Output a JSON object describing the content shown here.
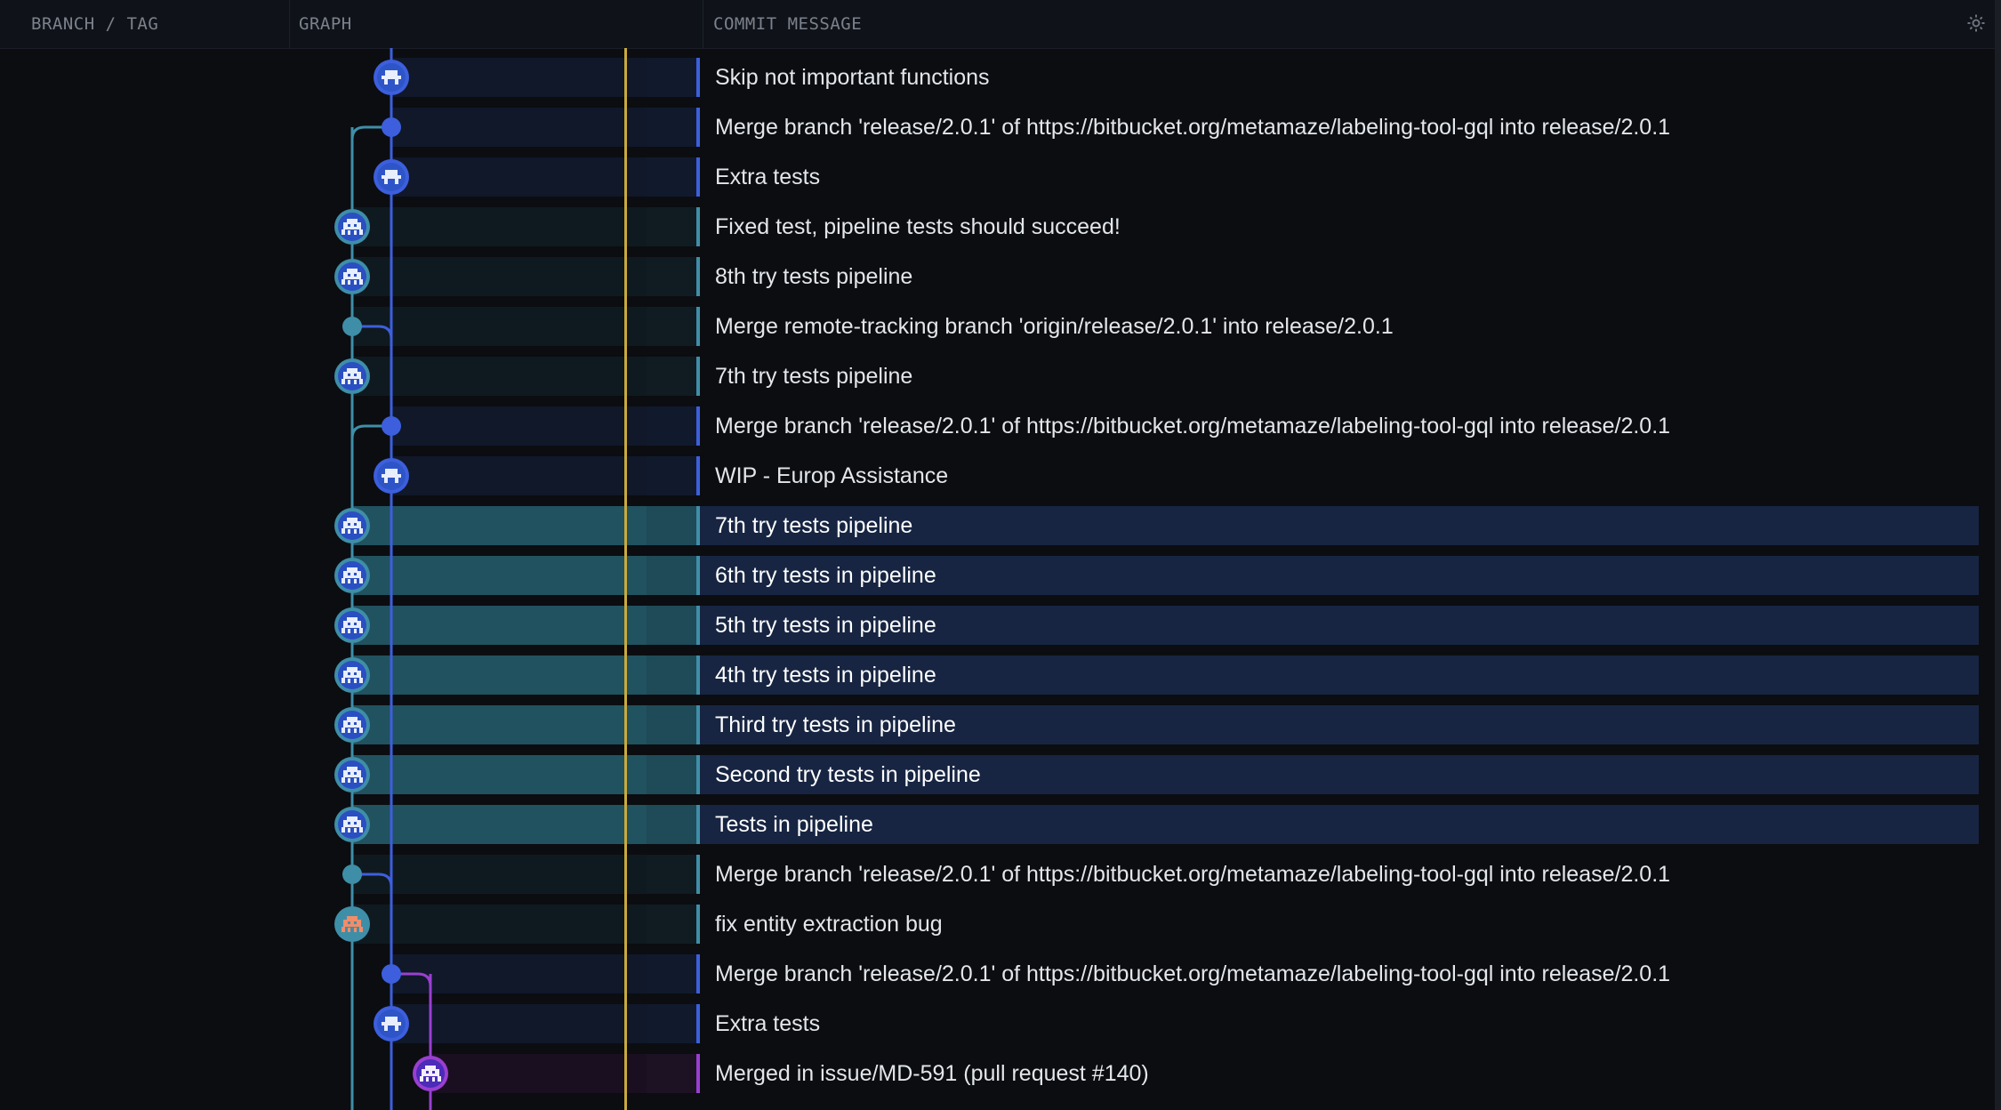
{
  "header": {
    "branch_tag": "BRANCH / TAG",
    "graph": "GRAPH",
    "commit_message": "COMMIT MESSAGE",
    "settings_icon": "gear-icon"
  },
  "colors": {
    "lane0": "#3f8ea8",
    "lane1": "#3d5fdd",
    "lane2": "#9a3fd0",
    "highlight": "#c9a93e",
    "selected_row": "#172542"
  },
  "commits": [
    {
      "message": "Skip not important functions",
      "lane": 1,
      "kind": "avatar",
      "avatar": "blue-robot",
      "selected": false
    },
    {
      "message": "Merge branch 'release/2.0.1' of https://bitbucket.org/metamaze/labeling-tool-gql into release/2.0.1",
      "lane": 1,
      "kind": "merge",
      "selected": false
    },
    {
      "message": "Extra tests",
      "lane": 1,
      "kind": "avatar",
      "avatar": "blue-robot",
      "selected": false
    },
    {
      "message": "Fixed test, pipeline tests should succeed!",
      "lane": 0,
      "kind": "avatar",
      "avatar": "blue-invader",
      "selected": false
    },
    {
      "message": "8th try tests pipeline",
      "lane": 0,
      "kind": "avatar",
      "avatar": "blue-invader",
      "selected": false
    },
    {
      "message": "Merge remote-tracking branch 'origin/release/2.0.1' into release/2.0.1",
      "lane": 0,
      "kind": "merge",
      "selected": false
    },
    {
      "message": "7th try tests pipeline",
      "lane": 0,
      "kind": "avatar",
      "avatar": "blue-invader",
      "selected": false
    },
    {
      "message": "Merge branch 'release/2.0.1' of https://bitbucket.org/metamaze/labeling-tool-gql into release/2.0.1",
      "lane": 1,
      "kind": "merge",
      "selected": false
    },
    {
      "message": "WIP - Europ Assistance",
      "lane": 1,
      "kind": "avatar",
      "avatar": "blue-robot",
      "selected": false
    },
    {
      "message": "7th try tests pipeline",
      "lane": 0,
      "kind": "avatar",
      "avatar": "blue-invader",
      "selected": true
    },
    {
      "message": "6th try tests in pipeline",
      "lane": 0,
      "kind": "avatar",
      "avatar": "blue-invader",
      "selected": true
    },
    {
      "message": "5th try tests in pipeline",
      "lane": 0,
      "kind": "avatar",
      "avatar": "blue-invader",
      "selected": true
    },
    {
      "message": "4th try tests in pipeline",
      "lane": 0,
      "kind": "avatar",
      "avatar": "blue-invader",
      "selected": true
    },
    {
      "message": "Third try tests in pipeline",
      "lane": 0,
      "kind": "avatar",
      "avatar": "blue-invader",
      "selected": true
    },
    {
      "message": "Second try tests in pipeline",
      "lane": 0,
      "kind": "avatar",
      "avatar": "blue-invader",
      "selected": true
    },
    {
      "message": "Tests in pipeline",
      "lane": 0,
      "kind": "avatar",
      "avatar": "blue-invader",
      "selected": true
    },
    {
      "message": "Merge branch 'release/2.0.1' of https://bitbucket.org/metamaze/labeling-tool-gql into release/2.0.1",
      "lane": 0,
      "kind": "merge",
      "selected": false
    },
    {
      "message": "fix entity extraction bug",
      "lane": 0,
      "kind": "avatar",
      "avatar": "orange-invader",
      "selected": false
    },
    {
      "message": "Merge branch 'release/2.0.1' of https://bitbucket.org/metamaze/labeling-tool-gql into release/2.0.1",
      "lane": 1,
      "kind": "merge",
      "selected": false
    },
    {
      "message": "Extra tests",
      "lane": 1,
      "kind": "avatar",
      "avatar": "blue-robot",
      "selected": false
    },
    {
      "message": "Merged in issue/MD-591 (pull request #140)",
      "lane": 2,
      "kind": "avatar",
      "avatar": "purple-invader",
      "selected": false
    }
  ]
}
